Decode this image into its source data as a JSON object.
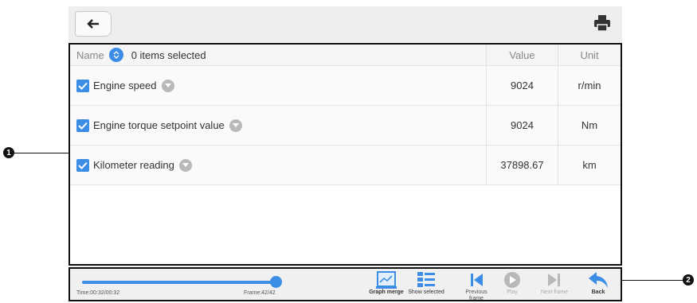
{
  "header": {
    "back_icon": "back-arrow-icon",
    "print_icon": "printer-icon"
  },
  "table": {
    "columns": {
      "name": "Name",
      "selected": "0 items selected",
      "value": "Value",
      "unit": "Unit"
    },
    "rows": [
      {
        "name": "Engine speed",
        "value": "9024",
        "unit": "r/min",
        "checked": true
      },
      {
        "name": "Engine torque setpoint value",
        "value": "9024",
        "unit": "Nm",
        "checked": true
      },
      {
        "name": "Kilometer reading",
        "value": "37898.67",
        "unit": "km",
        "checked": true
      }
    ]
  },
  "player": {
    "time": "Time:00:32/00:32",
    "frame": "Frame:42/42",
    "progress": 1.0,
    "tools": {
      "graph_merge": "Graph merge",
      "show_selected": "Show selected",
      "previous_frame": "Previous frame",
      "play": "Play",
      "next_frame": "Next frame",
      "back": "Back"
    }
  },
  "callouts": {
    "one": "1",
    "two": "2"
  },
  "colors": {
    "accent": "#3b8de6",
    "frame_border": "#111111"
  }
}
